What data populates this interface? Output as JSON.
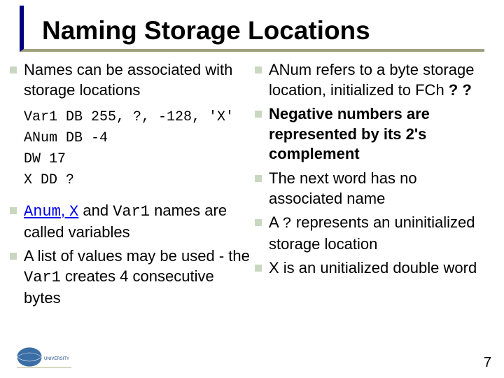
{
  "title": "Naming Storage Locations",
  "left": {
    "b1": "Names can be associated with storage locations",
    "code": "Var1 DB 255, ?, -128, 'X'\nANum DB -4\nDW 17\nX DD ?",
    "b2_pre": "",
    "b2_mono1": "Anum",
    "b2_sep1": ", ",
    "b2_mono2": "X",
    "b2_mid": " and ",
    "b2_mono3": "Var1",
    "b2_post": " names are called variables",
    "b3_pre": "A list of values may be used - the ",
    "b3_mono": "Var1",
    "b3_post": "  creates 4 consecutive bytes"
  },
  "right": {
    "r1_pre": "ANum refers to a byte storage location, initialized to FCh ",
    "r1_bold": "? ?",
    "r2": "Negative numbers are represented by its 2's complement",
    "r3": "The next word has no associated name",
    "r4_pre": "A ",
    "r4_mono": "?",
    "r4_post": " represents an uninitialized storage location",
    "r5": "X is an unitialized double word"
  },
  "page": "7"
}
